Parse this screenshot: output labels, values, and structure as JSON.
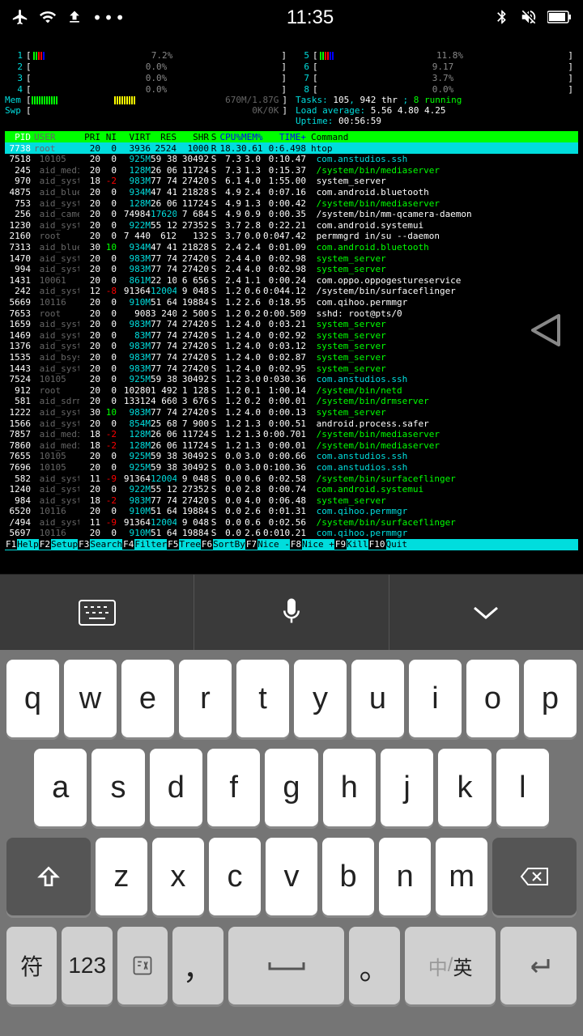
{
  "statusbar": {
    "time": "11:35"
  },
  "cpus": [
    {
      "n": "1",
      "bars": [
        "#0f0",
        "#0f0",
        "#f00",
        "#f00",
        "#00f"
      ],
      "pct": "7.2%"
    },
    {
      "n": "2",
      "bars": [],
      "pct": "0.0%"
    },
    {
      "n": "3",
      "bars": [],
      "pct": "0.0%"
    },
    {
      "n": "4",
      "bars": [],
      "pct": "0.0%"
    },
    {
      "n": "5",
      "bars": [
        "#0f0",
        "#0f0",
        "#f00",
        "#f00",
        "#00f",
        "#00f"
      ],
      "pct": "11.8%"
    },
    {
      "n": "6",
      "bars": [],
      "pct": "9.17"
    },
    {
      "n": "7",
      "bars": [],
      "pct": "3.7%"
    },
    {
      "n": "8",
      "bars": [],
      "pct": "0.0%"
    }
  ],
  "mem": {
    "label": "Mem",
    "val": "670M/1.87G"
  },
  "swp": {
    "label": "Swp",
    "val": "0K/0K"
  },
  "tasks": {
    "tasks": "105",
    "thr": "942 thr",
    "running": "8 running"
  },
  "load": {
    "l1": "5.56",
    "l2": "4.80",
    "l3": "4.25"
  },
  "uptime": "00:56:59",
  "header": [
    "PID",
    "USER",
    "PRI",
    "NI",
    "VIRT",
    "RES",
    "SHR",
    "S",
    "CPU%",
    "MEM%",
    "TIME+",
    "Command"
  ],
  "active": {
    "pid": "7738",
    "user": "root",
    "pri": "20",
    "ni": "0",
    "virt": "3936",
    "res": "2524",
    "shr": "1000",
    "s": "R",
    "cpu": "18.3",
    "mem": "0.61",
    "time": "0:6.498",
    "cmd": "htop"
  },
  "procs": [
    {
      "pid": "7518",
      "user": "10105",
      "pri": "20",
      "ni": "0",
      "virt": "925M",
      "res": "59 384",
      "shr": "30492",
      "s": "S",
      "cpu": "7.3",
      "mem": "3.0",
      "time": "0:10.47",
      "cmd": "com.anstudios.ssh",
      "color": "c",
      "vc": "c",
      "rc": "w"
    },
    {
      "pid": "245",
      "user": "aid_media",
      "pri": "20",
      "ni": "0",
      "virt": "128M",
      "res": "26 068",
      "shr": "11724",
      "s": "S",
      "cpu": "7.3",
      "mem": "1.3",
      "time": "0:15.37",
      "cmd": "/system/bin/mediaserver",
      "color": "g",
      "vc": "c",
      "rc": "w"
    },
    {
      "pid": "970",
      "user": "aid_syste",
      "pri": "18",
      "ni": "-2",
      "virt": "983M",
      "res": "77 748",
      "shr": "27420",
      "s": "S",
      "cpu": "6.1",
      "mem": "4.0",
      "time": "1:55.00",
      "cmd": "system_server",
      "color": "w",
      "vc": "c",
      "rc": "w",
      "nic": "r"
    },
    {
      "pid": "4875",
      "user": "aid_bluet",
      "pri": "20",
      "ni": "0",
      "virt": "934M",
      "res": "47 412",
      "shr": "21828",
      "s": "S",
      "cpu": "4.9",
      "mem": "2.4",
      "time": "0:07.16",
      "cmd": "com.android.bluetooth",
      "color": "w",
      "vc": "c",
      "rc": "w"
    },
    {
      "pid": "753",
      "user": "aid_syste",
      "pri": "20",
      "ni": "0",
      "virt": "128M",
      "res": "26 068",
      "shr": "11724",
      "s": "S",
      "cpu": "4.9",
      "mem": "1.3",
      "time": "0:00.42",
      "cmd": "/system/bin/mediaserver",
      "color": "g",
      "vc": "c",
      "rc": "w"
    },
    {
      "pid": "256",
      "user": "aid_camer",
      "pri": "20",
      "ni": "0",
      "virt": "74984",
      "res": "17620",
      "shr": "7 684",
      "s": "S",
      "cpu": "4.9",
      "mem": "0.9",
      "time": "0:00.35",
      "cmd": "/system/bin/mm-qcamera-daemon",
      "color": "w",
      "vc": "w",
      "rc": "c"
    },
    {
      "pid": "1230",
      "user": "aid_syste",
      "pri": "20",
      "ni": "0",
      "virt": "922M",
      "res": "55 128",
      "shr": "27352",
      "s": "S",
      "cpu": "3.7",
      "mem": "2.8",
      "time": "0:22.21",
      "cmd": "com.android.systemui",
      "color": "w",
      "vc": "c",
      "rc": "w"
    },
    {
      "pid": "2160",
      "user": "root",
      "pri": "20",
      "ni": "0",
      "virt": "7 440",
      "res": "612",
      "shr": "132",
      "s": "S",
      "cpu": "3.7",
      "mem": "0.0",
      "time": "0:047.42",
      "cmd": "permmgrd in/su --daemon",
      "color": "w",
      "vc": "w",
      "rc": "w"
    },
    {
      "pid": "7313",
      "user": "aid_bluet",
      "pri": "30",
      "ni": "10",
      "virt": "934M",
      "res": "47 412",
      "shr": "21828",
      "s": "S",
      "cpu": "2.4",
      "mem": "2.4",
      "time": "0:01.09",
      "cmd": "com.android.bluetooth",
      "color": "g",
      "vc": "c",
      "rc": "w",
      "nic": "g"
    },
    {
      "pid": "1470",
      "user": "aid_syste",
      "pri": "20",
      "ni": "0",
      "virt": "983M",
      "res": "77 748",
      "shr": "27420",
      "s": "S",
      "cpu": "2.4",
      "mem": "4.0",
      "time": "0:02.98",
      "cmd": "system_server",
      "color": "g",
      "vc": "c",
      "rc": "w"
    },
    {
      "pid": "994",
      "user": "aid_syste",
      "pri": "20",
      "ni": "0",
      "virt": "983M",
      "res": "77 748",
      "shr": "27420",
      "s": "S",
      "cpu": "2.4",
      "mem": "4.0",
      "time": "0:02.98",
      "cmd": "system_server",
      "color": "g",
      "vc": "c",
      "rc": "w"
    },
    {
      "pid": "1431",
      "user": "10061",
      "pri": "20",
      "ni": "0",
      "virt": "861M",
      "res": "22 108",
      "shr": "6 656",
      "s": "S",
      "cpu": "2.4",
      "mem": "1.1",
      "time": "0:00.24",
      "cmd": "com.oppo.oppogestureservice",
      "color": "w",
      "vc": "c",
      "rc": "w"
    },
    {
      "pid": "242",
      "user": "aid_syste",
      "pri": "12",
      "ni": "-8",
      "virt": "91364",
      "res": "12004",
      "shr": "9 048",
      "s": "S",
      "cpu": "1.2",
      "mem": "0.6",
      "time": "0:044.12",
      "cmd": "/system/bin/surfaceflinger",
      "color": "w",
      "vc": "w",
      "rc": "c",
      "nic": "r"
    },
    {
      "pid": "5669",
      "user": "10116",
      "pri": "20",
      "ni": "0",
      "virt": "910M",
      "res": "51 640",
      "shr": "19884",
      "s": "S",
      "cpu": "1.2",
      "mem": "2.6",
      "time": "0:18.95",
      "cmd": "com.qihoo.permmgr",
      "color": "w",
      "vc": "c",
      "rc": "w"
    },
    {
      "pid": "7653",
      "user": "root",
      "pri": "20",
      "ni": "0",
      "virt": "908",
      "res": "3 240",
      "shr": "2 500",
      "s": "S",
      "cpu": "1.2",
      "mem": "0.2",
      "time": "0:00.509",
      "cmd": "sshd: root@pts/0",
      "color": "w",
      "vc": "w",
      "rc": "w"
    },
    {
      "pid": "1659",
      "user": "aid_syste",
      "pri": "20",
      "ni": "0",
      "virt": "983M",
      "res": "77 748",
      "shr": "27420",
      "s": "S",
      "cpu": "1.2",
      "mem": "4.0",
      "time": "0:03.21",
      "cmd": "system_server",
      "color": "g",
      "vc": "c",
      "rc": "w"
    },
    {
      "pid": "1469",
      "user": "aid_syste",
      "pri": "20",
      "ni": "0",
      "virt": "83M",
      "res": "77 748",
      "shr": "27420",
      "s": "S",
      "cpu": "1.2",
      "mem": "4.0",
      "time": "0:02.92",
      "cmd": "system_server",
      "color": "g",
      "vc": "c",
      "rc": "w"
    },
    {
      "pid": "1376",
      "user": "aid_syste",
      "pri": "20",
      "ni": "0",
      "virt": "983M",
      "res": "77 748",
      "shr": "27420",
      "s": "S",
      "cpu": "1.2",
      "mem": "4.0",
      "time": "0:03.12",
      "cmd": "system_server",
      "color": "g",
      "vc": "c",
      "rc": "w"
    },
    {
      "pid": "1535",
      "user": "aid_bsyste",
      "pri": "20",
      "ni": "0",
      "virt": "983M",
      "res": "77 748",
      "shr": "27420",
      "s": "S",
      "cpu": "1.2",
      "mem": "4.0",
      "time": "0:02.87",
      "cmd": "system_server",
      "color": "g",
      "vc": "c",
      "rc": "w"
    },
    {
      "pid": "1443",
      "user": "aid_syste",
      "pri": "20",
      "ni": "0",
      "virt": "983M",
      "res": "77 748",
      "shr": "27420",
      "s": "S",
      "cpu": "1.2",
      "mem": "4.0",
      "time": "0:02.95",
      "cmd": "system_server",
      "color": "g",
      "vc": "c",
      "rc": "w"
    },
    {
      "pid": "7524",
      "user": "10105",
      "pri": "20",
      "ni": "0",
      "virt": "925M",
      "res": "59 384",
      "shr": "30492",
      "s": "S",
      "cpu": "1.2",
      "mem": "3.0",
      "time": "0:030.36",
      "cmd": "com.anstudios.ssh",
      "color": "c",
      "vc": "c",
      "rc": "w"
    },
    {
      "pid": "912",
      "user": "root",
      "pri": "20",
      "ni": "0",
      "virt": "10280",
      "res": "1 492",
      "shr": "1 128",
      "s": "S",
      "cpu": "1.2",
      "mem": "0.1",
      "time": "1:00.14",
      "cmd": "/system/bin/netd",
      "color": "g",
      "vc": "w",
      "rc": "w"
    },
    {
      "pid": "581",
      "user": "aid_sdrm",
      "pri": "20",
      "ni": "0",
      "virt": "13312",
      "res": "4 660",
      "shr": "3 676",
      "s": "S",
      "cpu": "1.2",
      "mem": "0.2",
      "time": "0:00.01",
      "cmd": "/system/bin/drmserver",
      "color": "g",
      "vc": "w",
      "rc": "w"
    },
    {
      "pid": "1222",
      "user": "aid_syste",
      "pri": "30",
      "ni": "10",
      "virt": "983M",
      "res": "77 748",
      "shr": "27420",
      "s": "S",
      "cpu": "1.2",
      "mem": "4.0",
      "time": "0:00.13",
      "cmd": "system_server",
      "color": "g",
      "vc": "c",
      "rc": "w",
      "nic": "g"
    },
    {
      "pid": "1566",
      "user": "aid_syste",
      "pri": "20",
      "ni": "0",
      "virt": "854M",
      "res": "25 688",
      "shr": "7 900",
      "s": "S",
      "cpu": "1.2",
      "mem": "1.3",
      "time": "0:00.51",
      "cmd": "android.process.safer",
      "color": "w",
      "vc": "c",
      "rc": "w"
    },
    {
      "pid": "7857",
      "user": "aid_media",
      "pri": "18",
      "ni": "-2",
      "virt": "128M",
      "res": "26 068",
      "shr": "11724",
      "s": "S",
      "cpu": "1.2",
      "mem": "1.3",
      "time": "0:00.701",
      "cmd": "/system/bin/mediaserver",
      "color": "g",
      "vc": "c",
      "rc": "w",
      "nic": "r"
    },
    {
      "pid": "7860",
      "user": "aid_media",
      "pri": "18",
      "ni": "-2",
      "virt": "128M",
      "res": "26 068",
      "shr": "11724",
      "s": "S",
      "cpu": "1.2",
      "mem": "1.3",
      "time": "0:00.01",
      "cmd": "/system/bin/mediaserver",
      "color": "g",
      "vc": "c",
      "rc": "w",
      "nic": "r"
    },
    {
      "pid": "7655",
      "user": "10105",
      "pri": "20",
      "ni": "0",
      "virt": "925M",
      "res": "59 384",
      "shr": "30492",
      "s": "S",
      "cpu": "0.0",
      "mem": "3.0",
      "time": "0:00.66",
      "cmd": "com.anstudios.ssh",
      "color": "c",
      "vc": "c",
      "rc": "w"
    },
    {
      "pid": "7696",
      "user": "10105",
      "pri": "20",
      "ni": "0",
      "virt": "925M",
      "res": "59 384",
      "shr": "30492",
      "s": "S",
      "cpu": "0.0",
      "mem": "3.0",
      "time": "0:100.36",
      "cmd": "com.anstudios.ssh",
      "color": "c",
      "vc": "c",
      "rc": "w"
    },
    {
      "pid": "582",
      "user": "aid_syste",
      "pri": "11",
      "ni": "-9",
      "virt": "91364",
      "res": "12004",
      "shr": "9 048",
      "s": "S",
      "cpu": "0.0",
      "mem": "0.6",
      "time": "0:02.58",
      "cmd": "/system/bin/surfaceflinger",
      "color": "g",
      "vc": "w",
      "rc": "c",
      "nic": "r"
    },
    {
      "pid": "1240",
      "user": "aid_syste",
      "pri": "20",
      "ni": "0",
      "virt": "922M",
      "res": "55 128",
      "shr": "27352",
      "s": "S",
      "cpu": "0.0",
      "mem": "2.8",
      "time": "0:00.74",
      "cmd": "com.android.systemui",
      "color": "g",
      "vc": "c",
      "rc": "w"
    },
    {
      "pid": "984",
      "user": "aid_syste",
      "pri": "18",
      "ni": "-2",
      "virt": "983M",
      "res": "77 748",
      "shr": "27420",
      "s": "S",
      "cpu": "0.0",
      "mem": "4.0",
      "time": "0:06.48",
      "cmd": "system_server",
      "color": "g",
      "vc": "c",
      "rc": "w",
      "nic": "r"
    },
    {
      "pid": "6520",
      "user": "10116",
      "pri": "20",
      "ni": "0",
      "virt": "910M",
      "res": "51 640",
      "shr": "19884",
      "s": "S",
      "cpu": "0.0",
      "mem": "2.6",
      "time": "0:01.31",
      "cmd": "com.qihoo.permmgr",
      "color": "c",
      "vc": "c",
      "rc": "w"
    },
    {
      "pid": "/494",
      "user": "aid_syste",
      "pri": "11",
      "ni": "-9",
      "virt": "91364",
      "res": "12004",
      "shr": "9 048",
      "s": "S",
      "cpu": "0.0",
      "mem": "0.6",
      "time": "0:02.56",
      "cmd": "/system/bin/surfaceflinger",
      "color": "g",
      "vc": "w",
      "rc": "c",
      "nic": "r"
    },
    {
      "pid": "5697",
      "user": "10116",
      "pri": "20",
      "ni": "0",
      "virt": "910M",
      "res": "51 640",
      "shr": "19884",
      "s": "S",
      "cpu": "0.0",
      "mem": "2.6",
      "time": "0:010.21",
      "cmd": "com.qihoo.permmgr",
      "color": "c",
      "vc": "c",
      "rc": "w"
    }
  ],
  "fnbar": [
    [
      "F1",
      "Help"
    ],
    [
      "F2",
      "Setup"
    ],
    [
      "F3",
      "Search"
    ],
    [
      "F4",
      "Filter"
    ],
    [
      "F5",
      "Tree"
    ],
    [
      "F6",
      "SortBy"
    ],
    [
      "F7",
      "Nice -"
    ],
    [
      "F8",
      "Nice +"
    ],
    [
      "F9",
      "Kill"
    ],
    [
      "F10",
      "Quit"
    ]
  ],
  "keys": {
    "row1": [
      "q",
      "w",
      "e",
      "r",
      "t",
      "y",
      "u",
      "i",
      "o",
      "p"
    ],
    "row2": [
      "a",
      "s",
      "d",
      "f",
      "g",
      "h",
      "j",
      "k",
      "l"
    ],
    "row3": [
      "z",
      "x",
      "c",
      "v",
      "b",
      "n",
      "m"
    ],
    "sym": "符",
    "num": "123",
    "comma": "，",
    "period": "。",
    "lang_cn": "中",
    "lang_en": "英"
  }
}
